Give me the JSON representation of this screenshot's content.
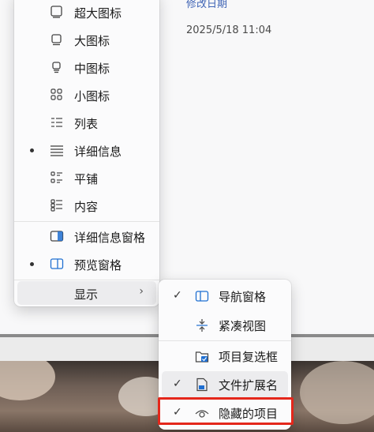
{
  "content": {
    "column_header": "修改日期",
    "modified_value": "2025/5/18 11:04"
  },
  "menu": {
    "items": [
      {
        "label": "超大图标",
        "icon": "extra-large-icons-icon",
        "checked": false
      },
      {
        "label": "大图标",
        "icon": "large-icons-icon",
        "checked": false
      },
      {
        "label": "中图标",
        "icon": "medium-icons-icon",
        "checked": false
      },
      {
        "label": "小图标",
        "icon": "small-icons-icon",
        "checked": false
      },
      {
        "label": "列表",
        "icon": "list-icon",
        "checked": false
      },
      {
        "label": "详细信息",
        "icon": "details-icon",
        "checked": true
      },
      {
        "label": "平铺",
        "icon": "tiles-icon",
        "checked": false
      },
      {
        "label": "内容",
        "icon": "content-icon",
        "checked": false
      },
      {
        "label": "详细信息窗格",
        "icon": "details-pane-icon",
        "checked": false
      },
      {
        "label": "预览窗格",
        "icon": "preview-pane-icon",
        "checked": true
      },
      {
        "label": "显示",
        "icon": "",
        "checked": false
      }
    ],
    "show_chevron": "›"
  },
  "submenu": {
    "items": [
      {
        "label": "导航窗格",
        "icon": "navigation-pane-icon",
        "check": "✓"
      },
      {
        "label": "紧凑视图",
        "icon": "compact-view-icon",
        "check": ""
      },
      {
        "label": "项目复选框",
        "icon": "item-checkbox-icon",
        "check": ""
      },
      {
        "label": "文件扩展名",
        "icon": "file-extension-icon",
        "check": "✓"
      },
      {
        "label": "隐藏的项目",
        "icon": "hidden-items-icon",
        "check": "✓"
      }
    ]
  },
  "colors": {
    "highlight": "#e4271b",
    "accent": "#1f6fd1"
  }
}
